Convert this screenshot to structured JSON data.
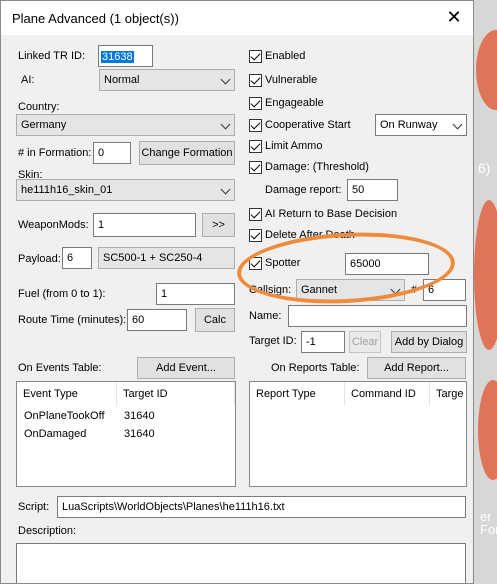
{
  "window": {
    "title": "Plane Advanced (1 object(s))"
  },
  "fields": {
    "linked_tr_id_label": "Linked TR ID:",
    "linked_tr_id_value": "31638",
    "ai_label": "AI:",
    "ai_value": "Normal",
    "country_label": "Country:",
    "country_value": "Germany",
    "formation_label": "# in Formation:",
    "formation_value": "0",
    "change_formation": "Change Formation",
    "skin_label": "Skin:",
    "skin_value": "he111h16_skin_01",
    "weaponmods_label": "WeaponMods:",
    "weaponmods_value": "1",
    "weaponmods_button": ">>",
    "payload_label": "Payload:",
    "payload_value": "6",
    "payload_desc": "SC500-1 + SC250-4",
    "fuel_label": "Fuel (from 0 to 1):",
    "fuel_value": "1",
    "route_time_label": "Route Time (minutes):",
    "route_time_value": "60",
    "calc_button": "Calc"
  },
  "checks": {
    "enabled": "Enabled",
    "vulnerable": "Vulnerable",
    "engageable": "Engageable",
    "cooperative_start": "Cooperative Start",
    "cooperative_value": "On Runway",
    "limit_ammo": "Limit Ammo",
    "damage_threshold": "Damage: (Threshold)",
    "damage_report_label": "Damage report:",
    "damage_report_value": "50",
    "ai_return": "AI Return to Base Decision",
    "delete_after_death": "Delete After Death",
    "spotter": "Spotter",
    "spotter_value": "65000",
    "callsign_label": "Callsign:",
    "callsign_value": "Gannet",
    "hash_label": "#",
    "hash_value": "6",
    "name_label": "Name:",
    "name_value": "",
    "target_id_label": "Target ID:",
    "target_id_value": "-1",
    "clear_button": "Clear",
    "add_by_dialog": "Add by Dialog"
  },
  "events": {
    "label": "On Events Table:",
    "add_button": "Add Event...",
    "col1": "Event Type",
    "col2": "Target ID",
    "rows": [
      {
        "type": "OnPlaneTookOff",
        "target": "31640"
      },
      {
        "type": "OnDamaged",
        "target": "31640"
      }
    ]
  },
  "reports": {
    "label": "On Reports Table:",
    "add_button": "Add Report...",
    "col1": "Report Type",
    "col2": "Command ID",
    "col3": "Targe"
  },
  "script": {
    "label": "Script:",
    "value": "LuaScripts\\WorldObjects\\Planes\\he111h16.txt"
  },
  "description": {
    "label": "Description:",
    "value": ""
  },
  "background": {
    "fragment1": "6)",
    "fragment2": "er\nFor"
  },
  "colors": {
    "highlight": "#0078d7",
    "annotation_ring": "#ef8b3a"
  }
}
